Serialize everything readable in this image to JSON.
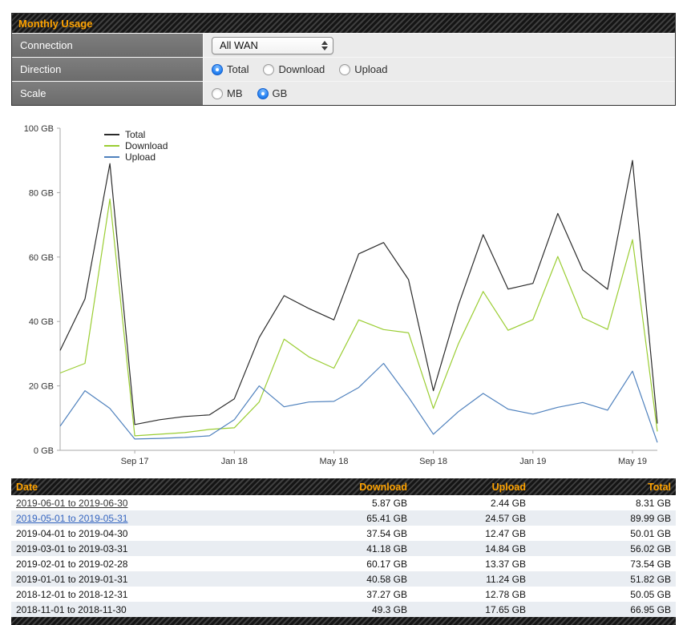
{
  "panel": {
    "title": "Monthly Usage",
    "rows": [
      {
        "label": "Connection",
        "control": "select",
        "value": "All WAN"
      },
      {
        "label": "Direction",
        "control": "radio-group",
        "options": [
          {
            "label": "Total",
            "selected": true
          },
          {
            "label": "Download",
            "selected": false
          },
          {
            "label": "Upload",
            "selected": false
          }
        ]
      },
      {
        "label": "Scale",
        "control": "radio-group",
        "options": [
          {
            "label": "MB",
            "selected": false
          },
          {
            "label": "GB",
            "selected": true
          }
        ]
      }
    ]
  },
  "chart_data": {
    "type": "line",
    "x": [
      "2017-06",
      "2017-07",
      "2017-08",
      "2017-09",
      "2017-10",
      "2017-11",
      "2017-12",
      "2018-01",
      "2018-02",
      "2018-03",
      "2018-04",
      "2018-05",
      "2018-06",
      "2018-07",
      "2018-08",
      "2018-09",
      "2018-10",
      "2018-11",
      "2018-12",
      "2019-01",
      "2019-02",
      "2019-03",
      "2019-04",
      "2019-05",
      "2019-06"
    ],
    "series": [
      {
        "name": "Total",
        "color": "#2b2b2b",
        "values": [
          31,
          47,
          89,
          8,
          9.5,
          10.5,
          11,
          16,
          35,
          48,
          44,
          40.5,
          61,
          64.5,
          53,
          18.5,
          45,
          66.95,
          50.05,
          51.82,
          73.54,
          56.02,
          50.01,
          89.99,
          8.31
        ]
      },
      {
        "name": "Download",
        "color": "#9acd32",
        "values": [
          24,
          27,
          78,
          4.5,
          5,
          5.5,
          6.5,
          7,
          15,
          34.5,
          29,
          25.5,
          40.5,
          37.5,
          36.5,
          13,
          33,
          49.3,
          37.27,
          40.58,
          60.17,
          41.18,
          37.54,
          65.41,
          5.87
        ]
      },
      {
        "name": "Upload",
        "color": "#4f81bd",
        "values": [
          7.5,
          18.5,
          13,
          3.5,
          3.7,
          4,
          4.5,
          9.5,
          20,
          13.5,
          15,
          15.2,
          19.5,
          27,
          16.5,
          5,
          12,
          17.65,
          12.78,
          11.24,
          13.37,
          14.84,
          12.47,
          24.57,
          2.44
        ]
      }
    ],
    "ylim": [
      0,
      100
    ],
    "y_unit": "GB",
    "yticks": [
      {
        "value": 0,
        "label": "0 GB"
      },
      {
        "value": 20,
        "label": "20 GB"
      },
      {
        "value": 40,
        "label": "40 GB"
      },
      {
        "value": 60,
        "label": "60 GB"
      },
      {
        "value": 80,
        "label": "80 GB"
      },
      {
        "value": 100,
        "label": "100 GB"
      }
    ],
    "xticks": [
      {
        "index": 3,
        "label": "Sep 17"
      },
      {
        "index": 7,
        "label": "Jan 18"
      },
      {
        "index": 11,
        "label": "May 18"
      },
      {
        "index": 15,
        "label": "Sep 18"
      },
      {
        "index": 19,
        "label": "Jan 19"
      },
      {
        "index": 23,
        "label": "May 19"
      }
    ],
    "legend_position": "top-left",
    "grid": false
  },
  "table": {
    "headers": {
      "date": "Date",
      "download": "Download",
      "upload": "Upload",
      "total": "Total"
    },
    "rows": [
      {
        "date": "2019-06-01 to 2019-06-30",
        "download": "5.87 GB",
        "upload": "2.44 GB",
        "total": "8.31 GB",
        "date_style": "link-dark"
      },
      {
        "date": "2019-05-01 to 2019-05-31",
        "download": "65.41 GB",
        "upload": "24.57 GB",
        "total": "89.99 GB",
        "date_style": "link-blue"
      },
      {
        "date": "2019-04-01 to 2019-04-30",
        "download": "37.54 GB",
        "upload": "12.47 GB",
        "total": "50.01 GB",
        "date_style": "plain"
      },
      {
        "date": "2019-03-01 to 2019-03-31",
        "download": "41.18 GB",
        "upload": "14.84 GB",
        "total": "56.02 GB",
        "date_style": "plain"
      },
      {
        "date": "2019-02-01 to 2019-02-28",
        "download": "60.17 GB",
        "upload": "13.37 GB",
        "total": "73.54 GB",
        "date_style": "plain"
      },
      {
        "date": "2019-01-01 to 2019-01-31",
        "download": "40.58 GB",
        "upload": "11.24 GB",
        "total": "51.82 GB",
        "date_style": "plain"
      },
      {
        "date": "2018-12-01 to 2018-12-31",
        "download": "37.27 GB",
        "upload": "12.78 GB",
        "total": "50.05 GB",
        "date_style": "plain"
      },
      {
        "date": "2018-11-01 to 2018-11-30",
        "download": "49.3 GB",
        "upload": "17.65 GB",
        "total": "66.95 GB",
        "date_style": "plain"
      }
    ]
  },
  "colors": {
    "accent_orange": "#ffa300",
    "link_blue": "#3565c0",
    "radio_blue": "#2a86f5",
    "axis_gray": "#aaaaaa"
  }
}
